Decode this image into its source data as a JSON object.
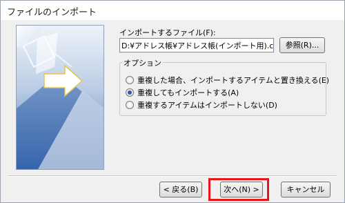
{
  "window": {
    "title": "ファイルのインポート"
  },
  "file": {
    "label": "インポートするファイル(F):",
    "value": "D:¥アドレス帳¥アドレス帳(インポート用).csv",
    "browse_label": "参照(R)..."
  },
  "options": {
    "legend": "オプション",
    "items": [
      {
        "label": "重複した場合、インポートするアイテムと置き換える(E)",
        "selected": false
      },
      {
        "label": "重複してもインポートする(A)",
        "selected": true
      },
      {
        "label": "重複するアイテムはインポートしない(D)",
        "selected": false
      }
    ]
  },
  "footer": {
    "back_label": "< 戻る(B)",
    "next_label": "次へ(N) >",
    "cancel_label": "キャンセル"
  },
  "colors": {
    "highlight": "#e8141c",
    "accent": "#2a5aa8"
  }
}
